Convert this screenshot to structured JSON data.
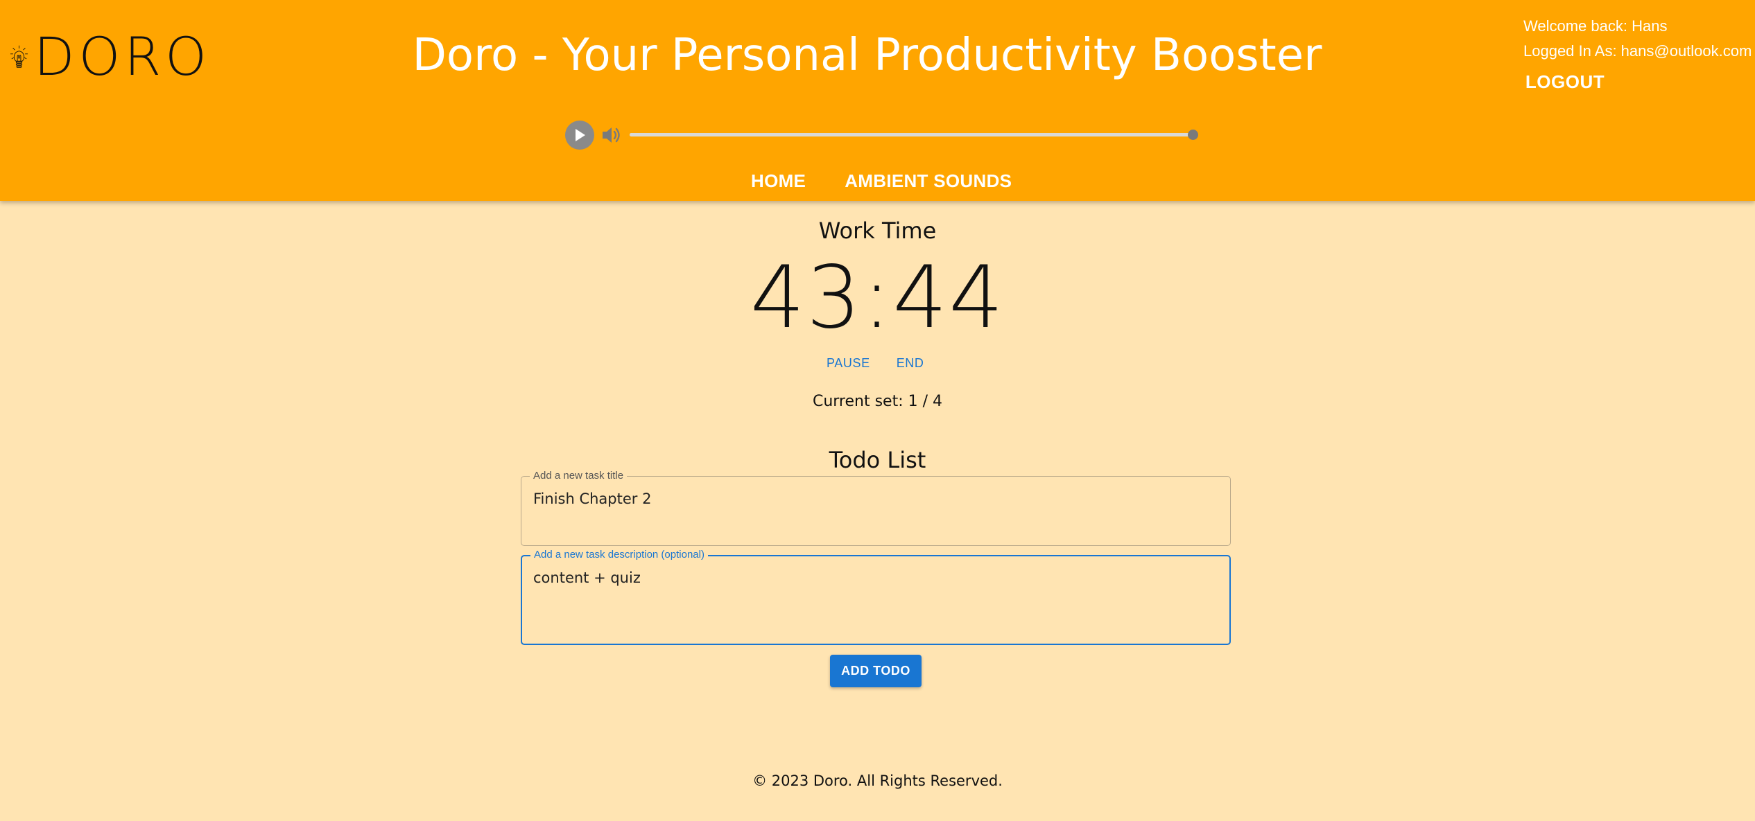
{
  "header": {
    "logo_text": "DORO",
    "title": "Doro - Your Personal Productivity Booster",
    "welcome": "Welcome back: Hans",
    "logged_in": "Logged In As: hans@outlook.com",
    "logout_label": "LOGOUT",
    "background_color": "#ffa500"
  },
  "player": {
    "progress": 1.0,
    "play_icon": "play-icon",
    "volume_icon": "volume-icon"
  },
  "nav": {
    "items": [
      {
        "label": "HOME"
      },
      {
        "label": "AMBIENT SOUNDS"
      }
    ]
  },
  "timer": {
    "phase": "Work Time",
    "time": "43:44",
    "pause_label": "PAUSE",
    "end_label": "END",
    "set_info": "Current set: 1 / 4"
  },
  "todo": {
    "title": "Todo List",
    "title_field": {
      "label": "Add a new task title",
      "value": "Finish Chapter 2"
    },
    "description_field": {
      "label": "Add a new task description (optional)",
      "value": "content + quiz"
    },
    "add_label": "ADD TODO",
    "accent_color": "#1976d2"
  },
  "footer": {
    "text": "© 2023 Doro. All Rights Reserved."
  },
  "page": {
    "background_color": "#ffe4b2"
  }
}
